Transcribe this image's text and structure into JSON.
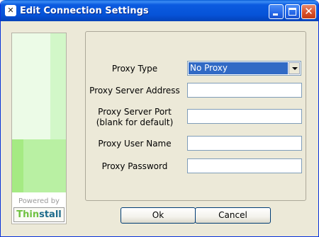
{
  "window": {
    "title": "Edit Connection Settings",
    "icon": "thinstall-app-icon"
  },
  "brand": {
    "powered_by": "Powered by",
    "logo_part1": "Thin",
    "logo_part2": "stall"
  },
  "form": {
    "proxy_type": {
      "label": "Proxy Type",
      "value": "No Proxy"
    },
    "server_address": {
      "label": "Proxy Server Address",
      "value": ""
    },
    "server_port": {
      "label_line1": "Proxy Server Port",
      "label_line2": "(blank for default)",
      "value": ""
    },
    "user_name": {
      "label": "Proxy User Name",
      "value": ""
    },
    "password": {
      "label": "Proxy Password",
      "value": ""
    }
  },
  "buttons": {
    "ok": "Ok",
    "cancel": "Cancel"
  },
  "colors": {
    "titlebar": "#0653d8",
    "selection": "#316ac5",
    "dialog_bg": "#ece9d8"
  }
}
